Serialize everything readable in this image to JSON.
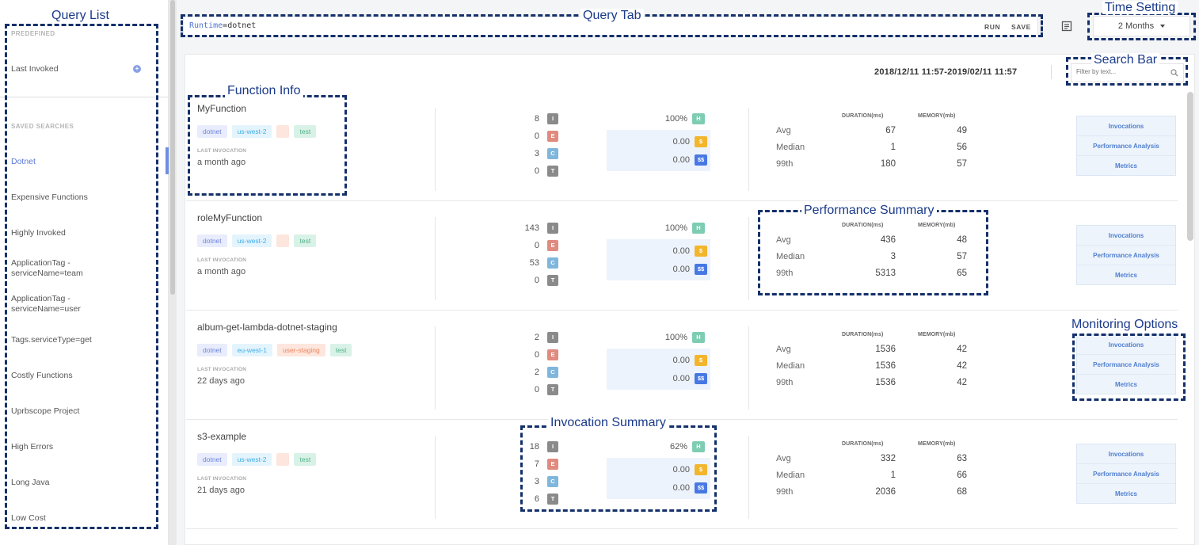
{
  "sidebar": {
    "predefined_label": "PREDEFINED",
    "predefined_items": [
      {
        "label": "Last Invoked"
      }
    ],
    "saved_label": "SAVED SEARCHES",
    "saved_items": [
      {
        "label": "Dotnet",
        "active": true
      },
      {
        "label": "Expensive Functions"
      },
      {
        "label": "Highly Invoked"
      },
      {
        "label": "ApplicationTag - serviceName=team"
      },
      {
        "label": "ApplicationTag - serviceName=user"
      },
      {
        "label": "Tags.serviceType=get"
      },
      {
        "label": "Costly Functions"
      },
      {
        "label": "Uprbscope Project"
      },
      {
        "label": "High Errors"
      },
      {
        "label": "Long Java"
      },
      {
        "label": "Low Cost"
      }
    ]
  },
  "query": {
    "key": "Runtime",
    "op": "=",
    "value": "dotnet",
    "run_label": "RUN",
    "save_label": "SAVE"
  },
  "time_setting": {
    "label": "2 Months"
  },
  "date_range": "2018/12/11 11:57-2019/02/11 11:57",
  "search": {
    "placeholder": "Filter by text..."
  },
  "columns": {
    "last_invocation": "LAST INVOCATION",
    "duration": "DURATION(ms)",
    "memory": "MEMORY(mb)",
    "avg": "Avg",
    "median": "Median",
    "p99": "99th"
  },
  "badges": {
    "i": "I",
    "e": "E",
    "c": "C",
    "t": "T",
    "h": "H",
    "s": "$",
    "ss": "$$"
  },
  "monitoring": {
    "invocations": "Invocations",
    "performance": "Performance Analysis",
    "metrics": "Metrics"
  },
  "functions": [
    {
      "name": "MyFunction",
      "tags": {
        "runtime": "dotnet",
        "region": "us-west-2",
        "user": "",
        "env": "test"
      },
      "last": "a month ago",
      "counts": {
        "i": "8",
        "e": "0",
        "c": "3",
        "t": "0"
      },
      "health": "100%",
      "cost": "0.00",
      "cost_total": "0.00",
      "perf": {
        "avg": [
          "67",
          "49"
        ],
        "median": [
          "1",
          "56"
        ],
        "p99": [
          "180",
          "57"
        ]
      }
    },
    {
      "name": "roleMyFunction",
      "tags": {
        "runtime": "dotnet",
        "region": "us-west-2",
        "user": "",
        "env": "test"
      },
      "last": "a month ago",
      "counts": {
        "i": "143",
        "e": "0",
        "c": "53",
        "t": "0"
      },
      "health": "100%",
      "cost": "0.00",
      "cost_total": "0.00",
      "perf": {
        "avg": [
          "436",
          "48"
        ],
        "median": [
          "3",
          "57"
        ],
        "p99": [
          "5313",
          "65"
        ]
      }
    },
    {
      "name": "album-get-lambda-dotnet-staging",
      "tags": {
        "runtime": "dotnet",
        "region": "eu-west-1",
        "user": "user-staging",
        "env": "test"
      },
      "last": "22 days ago",
      "counts": {
        "i": "2",
        "e": "0",
        "c": "2",
        "t": "0"
      },
      "health": "100%",
      "cost": "0.00",
      "cost_total": "0.00",
      "perf": {
        "avg": [
          "1536",
          "42"
        ],
        "median": [
          "1536",
          "42"
        ],
        "p99": [
          "1536",
          "42"
        ]
      }
    },
    {
      "name": "s3-example",
      "tags": {
        "runtime": "dotnet",
        "region": "us-west-2",
        "user": "",
        "env": "test"
      },
      "last": "21 days ago",
      "counts": {
        "i": "18",
        "e": "7",
        "c": "3",
        "t": "6"
      },
      "health": "62%",
      "cost": "0.00",
      "cost_total": "0.00",
      "perf": {
        "avg": [
          "332",
          "63"
        ],
        "median": [
          "1",
          "66"
        ],
        "p99": [
          "2036",
          "68"
        ]
      }
    }
  ],
  "annotations": {
    "query_list": "Query List",
    "query_tab": "Query Tab",
    "time_setting": "Time Setting",
    "search_bar": "Search Bar",
    "function_info": "Function Info",
    "performance_summary": "Performance Summary",
    "monitoring_options": "Monitoring Options",
    "invocation_summary": "Invocation Summary"
  }
}
